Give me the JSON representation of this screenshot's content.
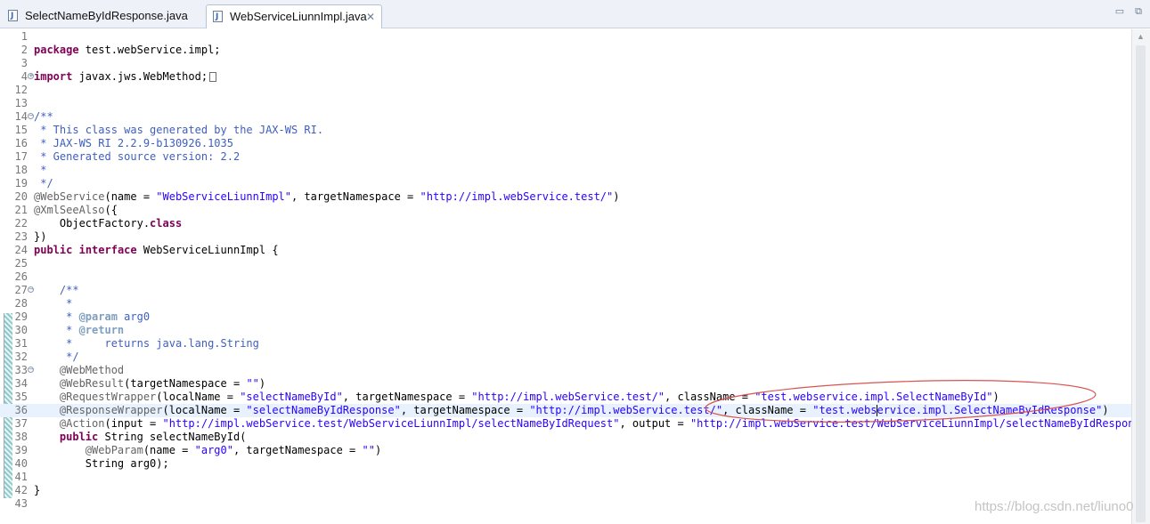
{
  "tabs": [
    {
      "label": "SelectNameByIdResponse.java",
      "active": false
    },
    {
      "label": "WebServiceLiunnImpl.java",
      "active": true
    }
  ],
  "window_controls": {
    "minimize": "▭",
    "restore": "⧉"
  },
  "icons": {
    "tab_close": "✕",
    "file": "java-file-icon",
    "fold": "⊖",
    "expand": "⊕"
  },
  "watermark": "https://blog.csdn.net/liuno0",
  "colors": {
    "keyword": "#7f0055",
    "string": "#2a00ff",
    "comment": "#3f5fbf",
    "annotation": "#646464",
    "ellipse": "#d9534f"
  },
  "lines": [
    {
      "n": "1"
    },
    {
      "n": "2"
    },
    {
      "n": "3"
    },
    {
      "n": "4"
    },
    {
      "n": "12"
    },
    {
      "n": "13"
    },
    {
      "n": "14"
    },
    {
      "n": "15"
    },
    {
      "n": "16"
    },
    {
      "n": "17"
    },
    {
      "n": "18"
    },
    {
      "n": "19"
    },
    {
      "n": "20"
    },
    {
      "n": "21"
    },
    {
      "n": "22"
    },
    {
      "n": "23"
    },
    {
      "n": "24"
    },
    {
      "n": "25"
    },
    {
      "n": "26"
    },
    {
      "n": "27"
    },
    {
      "n": "28"
    },
    {
      "n": "29"
    },
    {
      "n": "30"
    },
    {
      "n": "31"
    },
    {
      "n": "32"
    },
    {
      "n": "33"
    },
    {
      "n": "34"
    },
    {
      "n": "35"
    },
    {
      "n": "36"
    },
    {
      "n": "37"
    },
    {
      "n": "38"
    },
    {
      "n": "39"
    },
    {
      "n": "40"
    },
    {
      "n": "41"
    },
    {
      "n": "42"
    },
    {
      "n": "43"
    }
  ],
  "code": {
    "l2_kw": "package",
    "l2_rest": " test.webService.impl;",
    "l4_kw": "import",
    "l4_rest": " javax.jws.WebMethod;",
    "l14": "/**",
    "l15": " * This class was generated by the JAX-WS RI.",
    "l16": " * JAX-WS RI 2.2.9-b130926.1035",
    "l17": " * Generated source version: 2.2",
    "l18": " *",
    "l19": " */",
    "l20_ann": "@WebService",
    "l20_a": "(name = ",
    "l20_s1": "\"WebServiceLiunnImpl\"",
    "l20_b": ", targetNamespace = ",
    "l20_s2": "\"http://impl.webService.test/\"",
    "l20_c": ")",
    "l21_ann": "@XmlSeeAlso",
    "l21_rest": "({",
    "l22_a": "    ObjectFactory.",
    "l22_kw": "class",
    "l23": "})",
    "l24_kw1": "public",
    "l24_sp": " ",
    "l24_kw2": "interface",
    "l24_rest": " WebServiceLiunnImpl {",
    "l27": "    /**",
    "l28": "     *",
    "l29_a": "     * ",
    "l29_tag": "@param",
    "l29_b": " arg0",
    "l30_a": "     * ",
    "l30_tag": "@return",
    "l31": "     *     returns java.lang.String",
    "l32": "     */",
    "l33_ann": "    @WebMethod",
    "l34_ann": "    @WebResult",
    "l34_a": "(targetNamespace = ",
    "l34_s": "\"\"",
    "l34_b": ")",
    "l35_ann": "    @RequestWrapper",
    "l35_a": "(localName = ",
    "l35_s1": "\"selectNameById\"",
    "l35_b": ", targetNamespace = ",
    "l35_s2": "\"http://impl.webService.test/\"",
    "l35_c": ", className = ",
    "l35_s3": "\"test.webservice.impl.SelectNameById\"",
    "l35_d": ")",
    "l36_ann": "    @ResponseWrapper",
    "l36_a": "(localName = ",
    "l36_s1": "\"selectNameByIdResponse\"",
    "l36_b": ", targetNamespace = ",
    "l36_s2": "\"http://impl.webService.test/\"",
    "l36_c": ", className = ",
    "l36_s3a": "\"test.webs",
    "l36_s3b": "ervice.impl.SelectNameByIdResponse\"",
    "l36_d": ")",
    "l37_ann": "    @Action",
    "l37_a": "(input = ",
    "l37_s1": "\"http://impl.webService.test/WebServiceLiunnImpl/selectNameByIdRequest\"",
    "l37_b": ", output = ",
    "l37_s2": "\"http://impl.webService.test/WebServiceLiunnImpl/selectNameByIdResponse\"",
    "l37_c": ")",
    "l38_kw": "    public",
    "l38_rest": " String selectNameById(",
    "l39_ann": "        @WebParam",
    "l39_a": "(name = ",
    "l39_s1": "\"arg0\"",
    "l39_b": ", targetNamespace = ",
    "l39_s2": "\"\"",
    "l39_c": ")",
    "l40": "        String arg0);",
    "l42": "}"
  }
}
